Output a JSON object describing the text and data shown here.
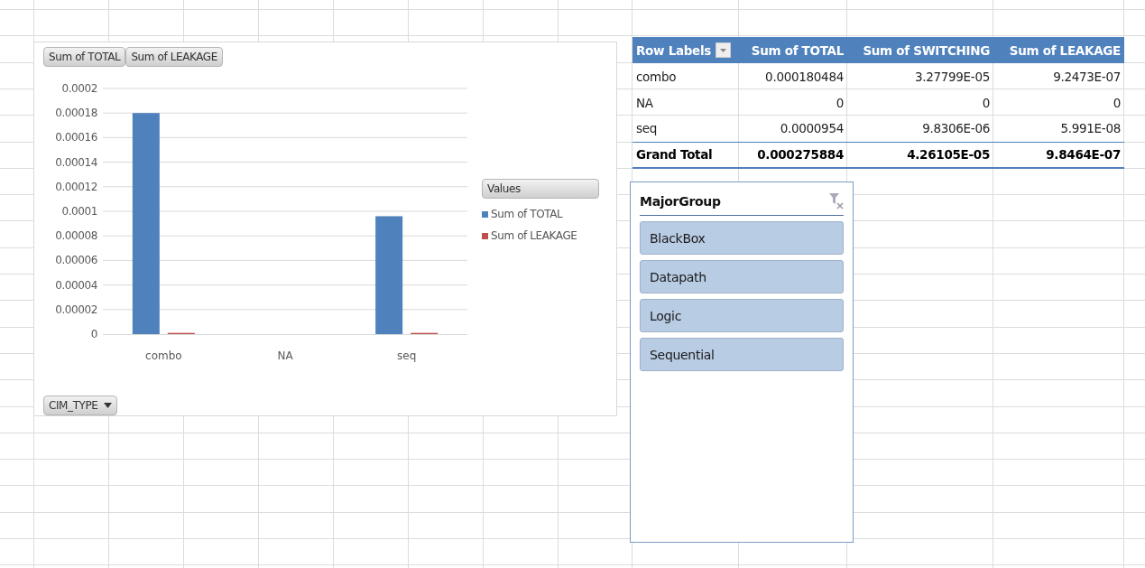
{
  "pivot_chart": {
    "value_field_buttons": [
      "Sum of TOTAL",
      "Sum of LEAKAGE"
    ],
    "legend_title": "Values",
    "axis_field_button": "CIM_TYPE",
    "chart_data": {
      "type": "bar",
      "categories": [
        "combo",
        "NA",
        "seq"
      ],
      "series": [
        {
          "name": "Sum of TOTAL",
          "color": "#4f81bd",
          "values": [
            0.00018,
            0,
            9.6e-05
          ]
        },
        {
          "name": "Sum of LEAKAGE",
          "color": "#c0504d",
          "values": [
            1e-06,
            0,
            1e-06
          ]
        }
      ],
      "grid": true,
      "ylim": [
        0,
        0.0002
      ],
      "yticks": [
        {
          "value": 0,
          "label": "0"
        },
        {
          "value": 2e-05,
          "label": "0.00002"
        },
        {
          "value": 4e-05,
          "label": "0.00004"
        },
        {
          "value": 6e-05,
          "label": "0.00006"
        },
        {
          "value": 8e-05,
          "label": "0.00008"
        },
        {
          "value": 0.0001,
          "label": "0.0001"
        },
        {
          "value": 0.00012,
          "label": "0.00012"
        },
        {
          "value": 0.00014,
          "label": "0.00014"
        },
        {
          "value": 0.00016,
          "label": "0.00016"
        },
        {
          "value": 0.00018,
          "label": "0.00018"
        },
        {
          "value": 0.0002,
          "label": "0.0002"
        }
      ]
    }
  },
  "pivot_table": {
    "columns": [
      "Row Labels",
      "Sum of TOTAL",
      "Sum of SWITCHING",
      "Sum of LEAKAGE"
    ],
    "rows": [
      [
        "combo",
        "0.000180484",
        "3.27799E-05",
        "9.2473E-07"
      ],
      [
        "NA",
        "0",
        "0",
        "0"
      ],
      [
        "seq",
        "0.0000954",
        "9.8306E-06",
        "5.991E-08"
      ]
    ],
    "grand_total": [
      "Grand Total",
      "0.000275884",
      "4.26105E-05",
      "9.8464E-07"
    ]
  },
  "slicer": {
    "title": "MajorGroup",
    "items": [
      {
        "label": "BlackBox",
        "selected": true
      },
      {
        "label": "Datapath",
        "selected": true
      },
      {
        "label": "Logic",
        "selected": true
      },
      {
        "label": "Sequential",
        "selected": true
      }
    ]
  }
}
